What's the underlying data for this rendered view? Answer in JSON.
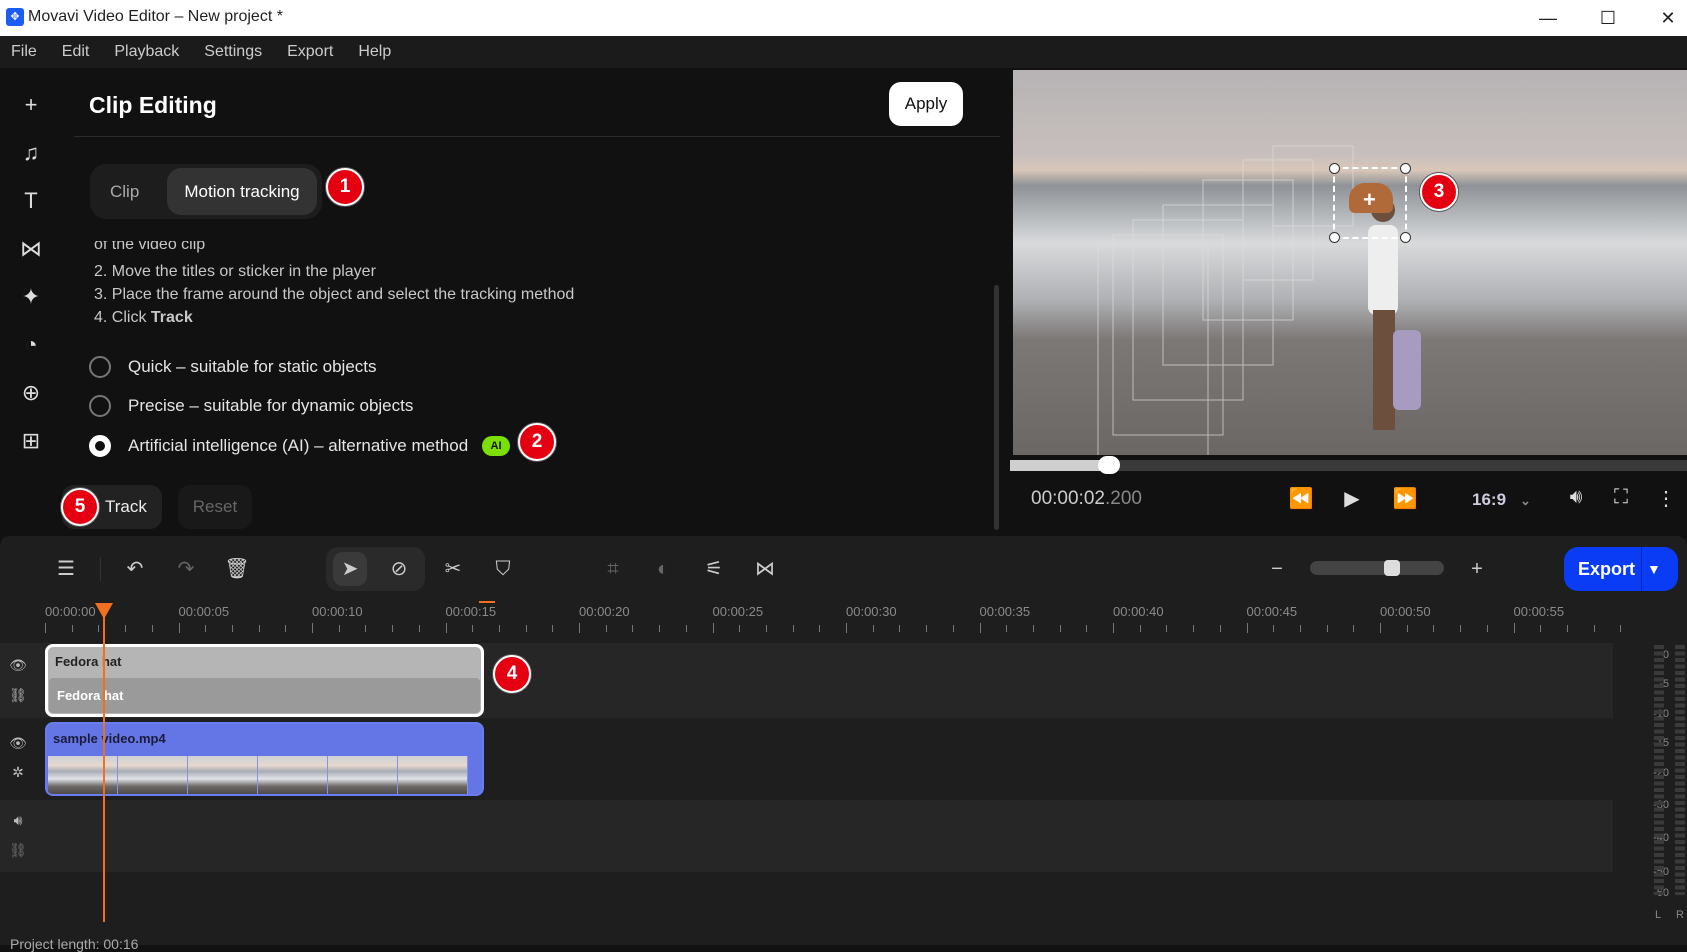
{
  "window": {
    "title": "Movavi Video Editor – New project *",
    "controls": [
      "minimize",
      "maximize",
      "close"
    ]
  },
  "menu": [
    "File",
    "Edit",
    "Playback",
    "Settings",
    "Export",
    "Help"
  ],
  "sidebar": [
    {
      "icon": "plus-icon",
      "glyph": "+"
    },
    {
      "icon": "music-icon",
      "glyph": "♫"
    },
    {
      "icon": "text-icon",
      "glyph": "T"
    },
    {
      "icon": "transitions-icon",
      "glyph": "⋈"
    },
    {
      "icon": "magic-icon",
      "glyph": "✦"
    },
    {
      "icon": "filters-icon",
      "glyph": "◔"
    },
    {
      "icon": "stickers-icon",
      "glyph": "⊕"
    },
    {
      "icon": "more-tools-icon",
      "glyph": "⊞"
    }
  ],
  "panel": {
    "title": "Clip Editing",
    "apply": "Apply",
    "tabs": [
      "Clip",
      "Motion tracking"
    ],
    "active_tab": "Motion tracking",
    "instructions": [
      "of the video clip",
      "2. Move the titles or sticker in the player",
      "3. Place the frame around the object and select the tracking method",
      "4. Click "
    ],
    "instruction_bold": "Track",
    "methods": [
      {
        "label": "Quick – suitable for static objects",
        "selected": false
      },
      {
        "label": "Precise – suitable for dynamic objects",
        "selected": false
      },
      {
        "label": "Artificial intelligence (AI) – alternative method",
        "selected": true
      }
    ],
    "ai_badge": "AI",
    "track": "Track",
    "reset": "Reset"
  },
  "callouts": [
    "1",
    "2",
    "3",
    "4",
    "5"
  ],
  "player": {
    "timecode_main": "00:00:02",
    "timecode_ms": ".200",
    "progress_percent": 4,
    "aspect": "16:9",
    "accent": "#1c5cf5"
  },
  "timeline": {
    "ruler": [
      "00:00:00",
      "00:00:05",
      "00:00:10",
      "00:00:15",
      "00:00:20",
      "00:00:25",
      "00:00:30",
      "00:00:35",
      "00:00:40",
      "00:00:45",
      "00:00:50",
      "00:00:55"
    ],
    "title_clip": {
      "label": "Fedora hat",
      "sublabel": "Fedora hat"
    },
    "video_clip": {
      "label": "sample video.mp4"
    },
    "export": "Export",
    "meter_labels": [
      "0",
      "-5",
      "-10",
      "-15",
      "-20",
      "-30",
      "-40",
      "-50",
      "-60"
    ],
    "meter_channels": [
      "L",
      "R"
    ],
    "project_length": "Project length: 00:16",
    "playhead_color": "#f07020",
    "export_color": "#0a3cf5"
  }
}
